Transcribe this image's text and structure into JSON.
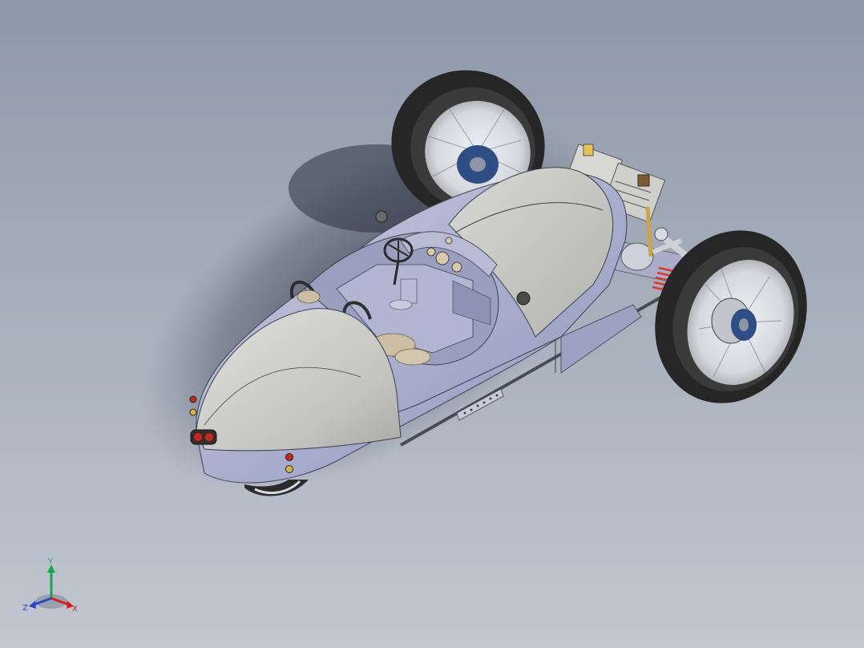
{
  "viewport": {
    "background_top": "#8d98a9",
    "background_bottom": "#c2c7d1"
  },
  "model": {
    "body_color": "#a8acca",
    "nose_color": "#c8c9c4",
    "tire_color": "#2b2b2b",
    "hub_color": "#2e4f86",
    "spring_color": "#d93a2f",
    "linkage_color": "#c9a54a"
  },
  "triad": {
    "x_label": "X",
    "y_label": "Y",
    "z_label": "Z",
    "x_color": "#d42020",
    "y_color": "#1aa64a",
    "z_color": "#2546c8"
  }
}
